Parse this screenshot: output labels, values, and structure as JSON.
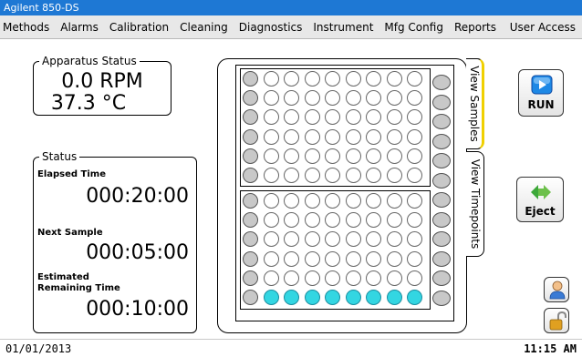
{
  "window": {
    "title": "Agilent 850-DS"
  },
  "menu": [
    {
      "label": "Methods"
    },
    {
      "label": "Alarms"
    },
    {
      "label": "Calibration"
    },
    {
      "label": "Cleaning"
    },
    {
      "label": "Diagnostics"
    },
    {
      "label": "Instrument"
    },
    {
      "label": "Mfg Config"
    },
    {
      "label": "Reports"
    },
    {
      "label": "User Access"
    }
  ],
  "apparatus": {
    "title": "Apparatus Status",
    "rpm_value": "0.0",
    "rpm_unit": "RPM",
    "temp_value": "37.3",
    "temp_unit": "°C"
  },
  "status": {
    "title": "Status",
    "elapsed_label": "Elapsed Time",
    "elapsed_value": "000:20:00",
    "next_label": "Next Sample",
    "next_value": "000:05:00",
    "remaining_label_line1": "Estimated",
    "remaining_label_line2": "Remaining Time",
    "remaining_value": "000:10:00"
  },
  "tabs": {
    "view_samples": "View Samples",
    "view_timepoints": "View Timepoints"
  },
  "buttons": {
    "run": "RUN",
    "eject": "Eject"
  },
  "plate": {
    "rows_per_block": 6,
    "cols": 9,
    "highlighted_row": "bottom block, row 6, columns 2-9"
  },
  "colors": {
    "titlebar": "#1e78d4",
    "active_well": "#33d6e2",
    "standard_well": "#c8c8c8",
    "selected_tab_accent": "#f0d000"
  },
  "statusbar": {
    "date": "01/01/2013",
    "time": "11:15 AM"
  }
}
